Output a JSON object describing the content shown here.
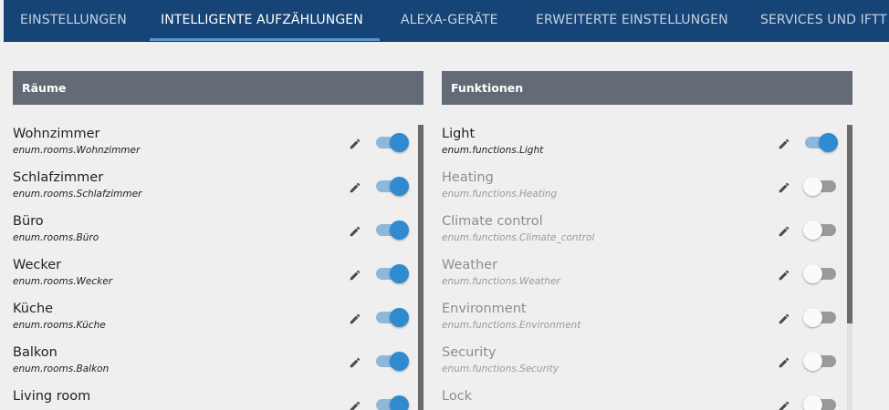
{
  "tabs": [
    {
      "label": "EINSTELLUNGEN",
      "active": false
    },
    {
      "label": "INTELLIGENTE AUFZÄHLUNGEN",
      "active": true
    },
    {
      "label": "ALEXA-GERÄTE",
      "active": false
    },
    {
      "label": "ERWEITERTE EINSTELLUNGEN",
      "active": false
    },
    {
      "label": "SERVICES UND IFTT",
      "active": false
    }
  ],
  "rooms": {
    "title": "Räume",
    "items": [
      {
        "label": "Wohnzimmer",
        "id": "enum.rooms.Wohnzimmer",
        "enabled": true
      },
      {
        "label": "Schlafzimmer",
        "id": "enum.rooms.Schlafzimmer",
        "enabled": true
      },
      {
        "label": "Büro",
        "id": "enum.rooms.Büro",
        "enabled": true
      },
      {
        "label": "Wecker",
        "id": "enum.rooms.Wecker",
        "enabled": true
      },
      {
        "label": "Küche",
        "id": "enum.rooms.Küche",
        "enabled": true
      },
      {
        "label": "Balkon",
        "id": "enum.rooms.Balkon",
        "enabled": true
      },
      {
        "label": "Living room",
        "id": "",
        "enabled": true
      }
    ]
  },
  "functions": {
    "title": "Funktionen",
    "items": [
      {
        "label": "Light",
        "id": "enum.functions.Light",
        "enabled": true
      },
      {
        "label": "Heating",
        "id": "enum.functions.Heating",
        "enabled": false
      },
      {
        "label": "Climate control",
        "id": "enum.functions.Climate_control",
        "enabled": false
      },
      {
        "label": "Weather",
        "id": "enum.functions.Weather",
        "enabled": false
      },
      {
        "label": "Environment",
        "id": "enum.functions.Environment",
        "enabled": false
      },
      {
        "label": "Security",
        "id": "enum.functions.Security",
        "enabled": false
      },
      {
        "label": "Lock",
        "id": "",
        "enabled": false
      }
    ]
  },
  "icons": {
    "edit": "pencil-icon"
  },
  "colors": {
    "tabbar": "#164477",
    "panel_header": "#626b76",
    "toggle_on": "#2f8bd0",
    "toggle_track_on": "#8fb7dc"
  }
}
